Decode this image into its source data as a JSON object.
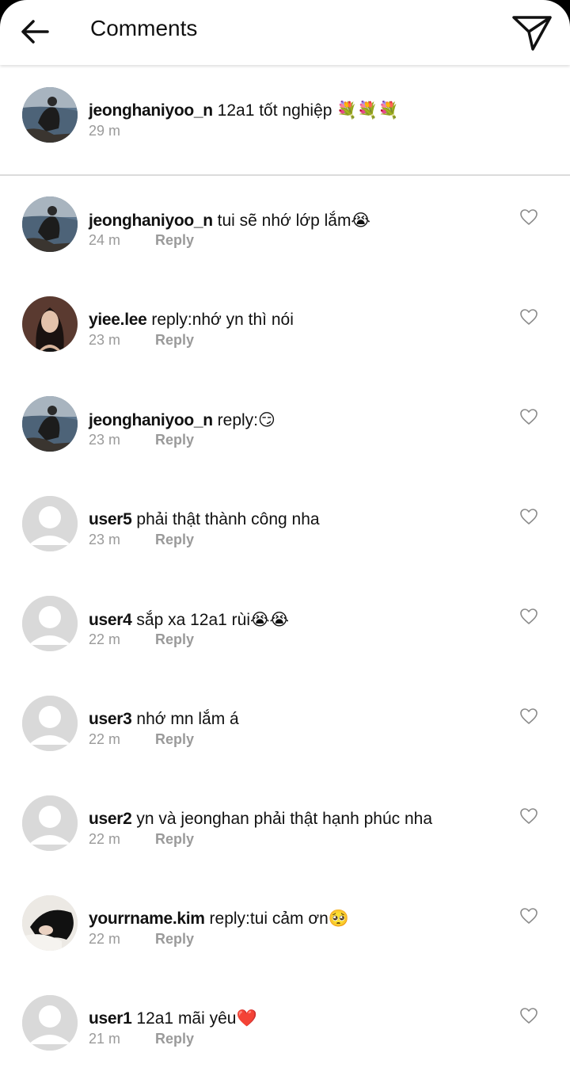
{
  "header": {
    "title": "Comments"
  },
  "post": {
    "avatar": "avatar-photo-person-by-sea",
    "username": "jeonghaniyoo_n",
    "text": "12a1 tốt nghiệp 💐💐💐",
    "time": "29 m"
  },
  "comments": [
    {
      "avatar": "avatar-photo-person-by-sea",
      "username": "jeonghaniyoo_n",
      "text": "tui sẽ nhớ lớp lắm😭",
      "time": "24 m",
      "reply": "Reply"
    },
    {
      "avatar": "avatar-photo-woman",
      "username": "yiee.lee",
      "text": "reply:nhớ yn thì nói",
      "time": "23 m",
      "reply": "Reply"
    },
    {
      "avatar": "avatar-photo-person-by-sea",
      "username": "jeonghaniyoo_n",
      "text": "reply:😏",
      "time": "23 m",
      "reply": "Reply"
    },
    {
      "avatar": "default-avatar",
      "username": "user5",
      "text": "phải thật thành công nha",
      "time": "23 m",
      "reply": "Reply"
    },
    {
      "avatar": "default-avatar",
      "username": "user4",
      "text": "sắp xa 12a1 rùi😭😭",
      "time": "22 m",
      "reply": "Reply"
    },
    {
      "avatar": "default-avatar",
      "username": "user3",
      "text": "nhớ mn lắm á",
      "time": "22 m",
      "reply": "Reply"
    },
    {
      "avatar": "default-avatar",
      "username": "user2",
      "text": "yn và jeonghan phải thật hạnh phúc nha",
      "time": "22 m",
      "reply": "Reply"
    },
    {
      "avatar": "avatar-photo-dark-hair",
      "username": "yourrname.kim",
      "text": "reply:tui cảm ơn🥺",
      "time": "22 m",
      "reply": "Reply"
    },
    {
      "avatar": "default-avatar",
      "username": "user1",
      "text": "12a1 mãi yêu❤️",
      "time": "21 m",
      "reply": "Reply"
    }
  ],
  "colors": {
    "muted_text": "#9a9a9a",
    "divider": "#dcdcdc",
    "default_avatar_bg": "#d9d9d9"
  }
}
